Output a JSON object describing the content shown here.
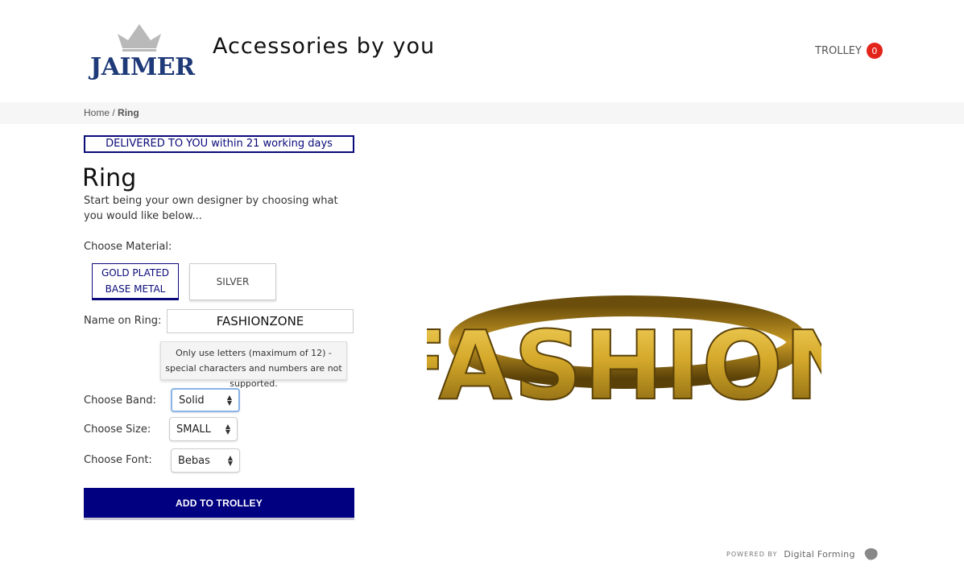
{
  "header": {
    "brand": "JAIMER",
    "tagline": "Accessories by you",
    "trolley_label": "TROLLEY",
    "trolley_count": "0"
  },
  "breadcrumb": {
    "home": "Home",
    "separator": "/",
    "current": "Ring"
  },
  "delivery_banner": "DELIVERED TO YOU within 21 working days",
  "product": {
    "title": "Ring",
    "intro": "Start being your own designer by choosing what you would like below..."
  },
  "material": {
    "label": "Choose Material:",
    "options": [
      {
        "line1": "GOLD PLATED",
        "line2": "BASE METAL",
        "selected": true
      },
      {
        "line1": "SILVER",
        "line2": "",
        "selected": false
      }
    ]
  },
  "name_field": {
    "label": "Name on Ring:",
    "value": "FASHIONZONE",
    "hint": "Only use letters (maximum of 12) - special characters and numbers are not supported."
  },
  "band": {
    "label": "Choose Band:",
    "value": "Solid"
  },
  "size": {
    "label": "Choose Size:",
    "value": "SMALL"
  },
  "font": {
    "label": "Choose Font:",
    "value": "Bebas"
  },
  "add_button": "ADD TO TROLLEY",
  "preview": {
    "ring_text": "FASHION"
  },
  "footer": {
    "powered_by": "POWERED BY",
    "brand": "Digital Forming"
  },
  "colors": {
    "navy": "#000080",
    "brand_blue": "#1f3a78",
    "badge_red": "#e3241b",
    "gold": "#d4a82a"
  }
}
